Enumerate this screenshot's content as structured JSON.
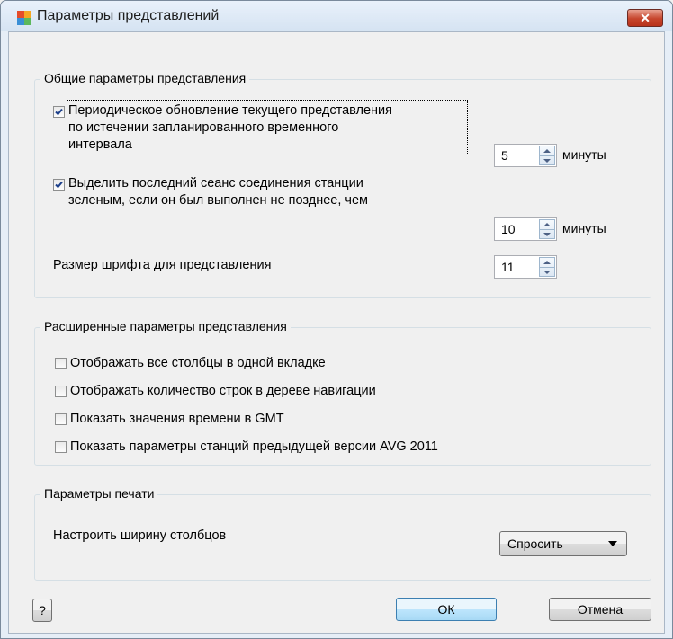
{
  "window": {
    "title": "Параметры представлений",
    "close_label": "✕"
  },
  "general": {
    "legend": "Общие параметры представления",
    "periodic_refresh": {
      "checked": true,
      "label_line1": "Периодическое обновление текущего представления",
      "label_line2": "по истечении запланированного временного",
      "label_line3": "интервала",
      "value": "5",
      "unit": "минуты"
    },
    "highlight_last_session": {
      "checked": true,
      "label_line1": "Выделить последний сеанс соединения станции",
      "label_line2": "зеленым, если он был выполнен не позднее, чем",
      "value": "10",
      "unit": "минуты"
    },
    "font_size": {
      "label": "Размер шрифта для представления",
      "value": "11"
    }
  },
  "advanced": {
    "legend": "Расширенные параметры представления",
    "options": [
      {
        "label": "Отображать все столбцы в одной вкладке",
        "checked": false
      },
      {
        "label": "Отображать количество строк в дереве навигации",
        "checked": false
      },
      {
        "label": "Показать значения времени в GMT",
        "checked": false
      },
      {
        "label": "Показать параметры станций предыдущей версии AVG 2011",
        "checked": false
      }
    ]
  },
  "print": {
    "legend": "Параметры печати",
    "column_width_label": "Настроить ширину столбцов",
    "column_width_value": "Спросить"
  },
  "buttons": {
    "help": "?",
    "ok": "ОК",
    "cancel": "Отмена"
  }
}
